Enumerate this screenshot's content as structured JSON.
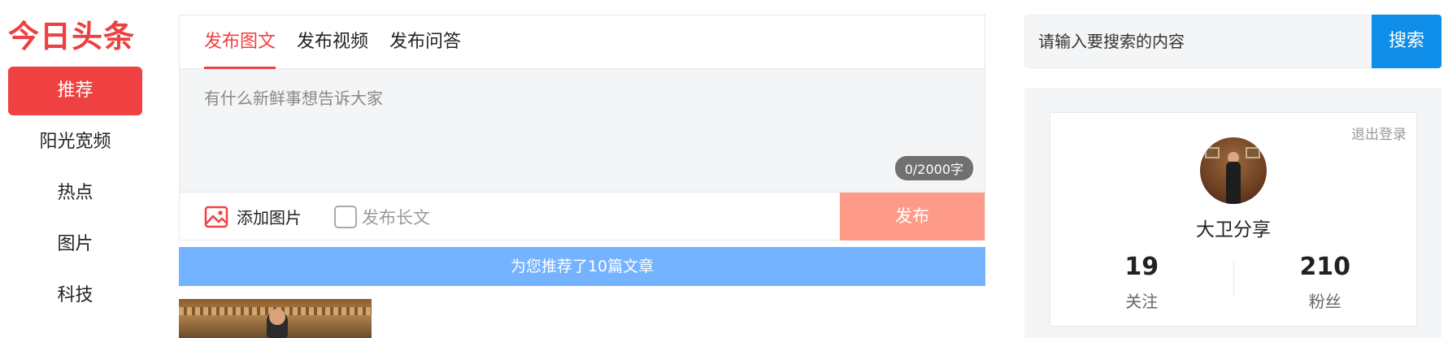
{
  "logo": {
    "text": "今日头条"
  },
  "nav": {
    "items": [
      {
        "label": "推荐"
      },
      {
        "label": "阳光宽频"
      },
      {
        "label": "热点"
      },
      {
        "label": "图片"
      },
      {
        "label": "科技"
      }
    ]
  },
  "publish": {
    "tabs": [
      "发布图文",
      "发布视频",
      "发布问答"
    ],
    "editor_placeholder": "有什么新鲜事想告诉大家",
    "counter": "0/2000字",
    "add_image_label": "添加图片",
    "long_text_label": "发布长文",
    "publish_button": "发布"
  },
  "banner": {
    "text": "为您推荐了10篇文章"
  },
  "search": {
    "placeholder": "请输入要搜索的内容",
    "button": "搜索"
  },
  "user": {
    "logout": "退出登录",
    "name": "大卫分享",
    "follow_count": "19",
    "follow_label": "关注",
    "fans_count": "210",
    "fans_label": "粉丝"
  },
  "colors": {
    "brand_red": "#f04142",
    "publish_button": "#fd9b88",
    "banner_blue": "#73b3ff",
    "search_blue": "#0f8ee9"
  }
}
